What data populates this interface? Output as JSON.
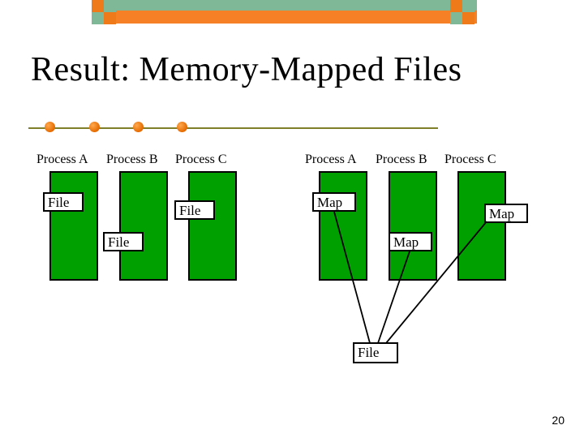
{
  "slide": {
    "title": "Result: Memory-Mapped Files",
    "page_number": "20"
  },
  "left": {
    "headers": [
      "Process A",
      "Process B",
      "Process C"
    ],
    "box_labels": [
      "File",
      "File",
      "File"
    ]
  },
  "right": {
    "headers": [
      "Process A",
      "Process B",
      "Process C"
    ],
    "box_labels": [
      "Map",
      "Map",
      "Map"
    ],
    "shared_file_label": "File"
  }
}
